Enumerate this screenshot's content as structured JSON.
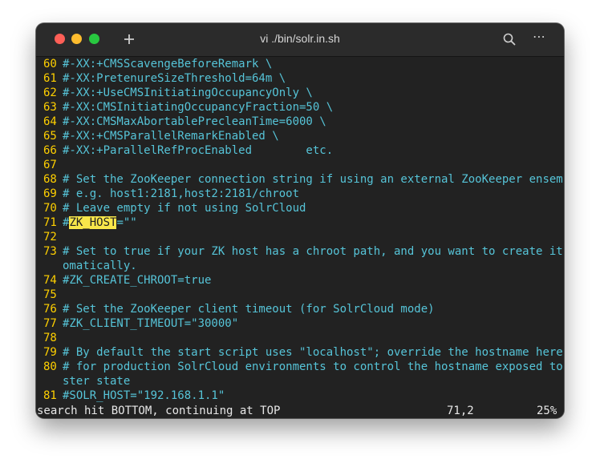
{
  "window": {
    "title": "vi ./bin/solr.in.sh"
  },
  "toolbar": {
    "new_tab_icon": "plus-icon",
    "search_icon": "search-icon",
    "more_label": "⋯"
  },
  "editor": {
    "lines": [
      {
        "num": "60",
        "text": "#-XX:+CMSScavengeBeforeRemark \\"
      },
      {
        "num": "61",
        "text": "#-XX:PretenureSizeThreshold=64m \\"
      },
      {
        "num": "62",
        "text": "#-XX:+UseCMSInitiatingOccupancyOnly \\"
      },
      {
        "num": "63",
        "text": "#-XX:CMSInitiatingOccupancyFraction=50 \\"
      },
      {
        "num": "64",
        "text": "#-XX:CMSMaxAbortablePrecleanTime=6000 \\"
      },
      {
        "num": "65",
        "text": "#-XX:+CMSParallelRemarkEnabled \\"
      },
      {
        "num": "66",
        "text": "#-XX:+ParallelRefProcEnabled        etc."
      },
      {
        "num": "67",
        "text": ""
      },
      {
        "num": "68",
        "text": "# Set the ZooKeeper connection string if using an external ZooKeeper ensemble"
      },
      {
        "num": "69",
        "text": "# e.g. host1:2181,host2:2181/chroot"
      },
      {
        "num": "70",
        "text": "# Leave empty if not using SolrCloud"
      },
      {
        "num": "71",
        "prefix": "#",
        "highlight": "ZK_HOST",
        "suffix": "=\"\""
      },
      {
        "num": "72",
        "text": ""
      },
      {
        "num": "73",
        "text": "# Set to true if your ZK host has a chroot path, and you want to create it aut"
      },
      {
        "num": "",
        "text": "omatically."
      },
      {
        "num": "74",
        "text": "#ZK_CREATE_CHROOT=true"
      },
      {
        "num": "75",
        "text": ""
      },
      {
        "num": "76",
        "text": "# Set the ZooKeeper client timeout (for SolrCloud mode)"
      },
      {
        "num": "77",
        "text": "#ZK_CLIENT_TIMEOUT=\"30000\""
      },
      {
        "num": "78",
        "text": ""
      },
      {
        "num": "79",
        "text": "# By default the start script uses \"localhost\"; override the hostname here"
      },
      {
        "num": "80",
        "text": "# for production SolrCloud environments to control the hostname exposed to clu"
      },
      {
        "num": "",
        "text": "ster state"
      },
      {
        "num": "81",
        "text": "#SOLR_HOST=\"192.168.1.1\""
      }
    ]
  },
  "status": {
    "message": "search hit BOTTOM, continuing at TOP",
    "position": "71,2",
    "percent": "25%"
  },
  "colors": {
    "line_number": "#ffd000",
    "text": "#56c4d8",
    "highlight": "#f8e74a",
    "background": "#222222"
  }
}
